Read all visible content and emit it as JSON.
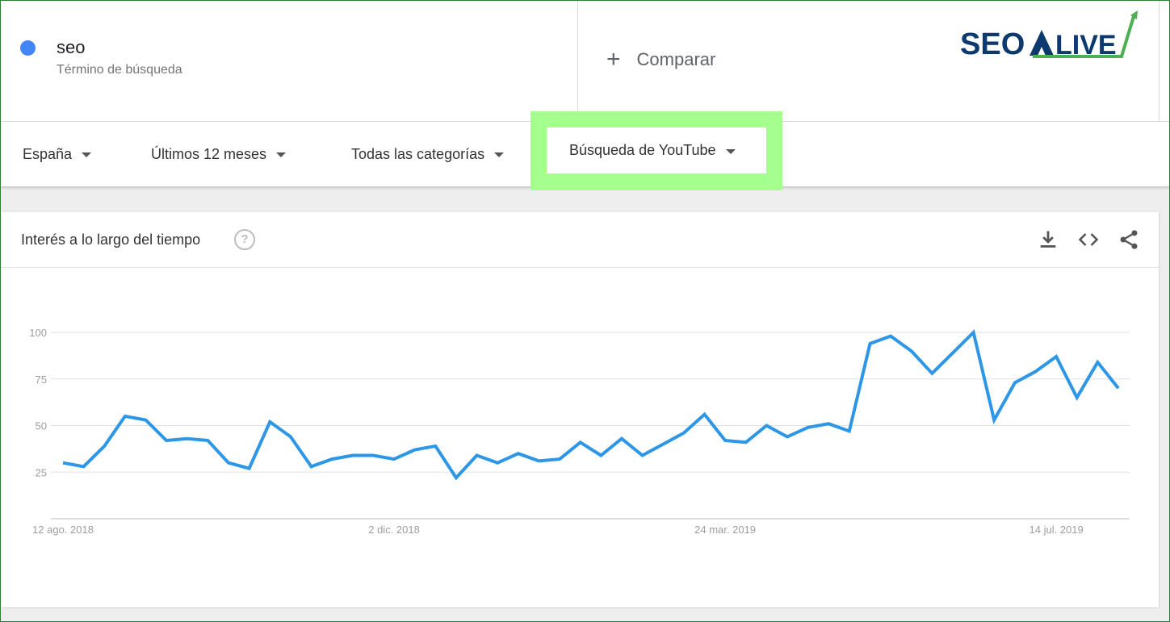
{
  "search_term": {
    "name": "seo",
    "type": "Término de búsqueda",
    "color": "#4285f4"
  },
  "compare": {
    "label": "Comparar"
  },
  "logo": {
    "text_left": "SEO",
    "text_right": "LIVE",
    "colors": {
      "navy": "#0d3a6e",
      "green": "#4caf50"
    }
  },
  "filters": {
    "region": "España",
    "period": "Últimos 12 meses",
    "category": "Todas las categorías",
    "search_type": "Búsqueda de YouTube"
  },
  "highlight_color": "#a5ff8e",
  "card": {
    "title": "Interés a lo largo del tiempo",
    "help_icon": "question-circle-icon",
    "tools": [
      "download-icon",
      "embed-code-icon",
      "share-icon"
    ]
  },
  "chart_data": {
    "type": "line",
    "title": "",
    "xlabel": "",
    "ylabel": "",
    "ylim": [
      0,
      100
    ],
    "yticks": [
      25,
      50,
      75,
      100
    ],
    "xticks": [
      {
        "label": "12 ago. 2018",
        "index": 0
      },
      {
        "label": "2 dic. 2018",
        "index": 16
      },
      {
        "label": "24 mar. 2019",
        "index": 32
      },
      {
        "label": "14 jul. 2019",
        "index": 48
      }
    ],
    "grid": true,
    "legend": "none",
    "series": [
      {
        "color": "#2d96e6",
        "values": [
          30,
          28,
          39,
          55,
          53,
          42,
          43,
          42,
          30,
          27,
          52,
          44,
          28,
          32,
          34,
          34,
          32,
          37,
          39,
          22,
          34,
          30,
          35,
          31,
          32,
          41,
          34,
          43,
          34,
          40,
          46,
          56,
          42,
          41,
          50,
          44,
          49,
          51,
          47,
          94,
          98,
          90,
          78,
          89,
          100,
          53,
          73,
          79,
          87,
          65,
          84,
          70
        ]
      }
    ]
  }
}
